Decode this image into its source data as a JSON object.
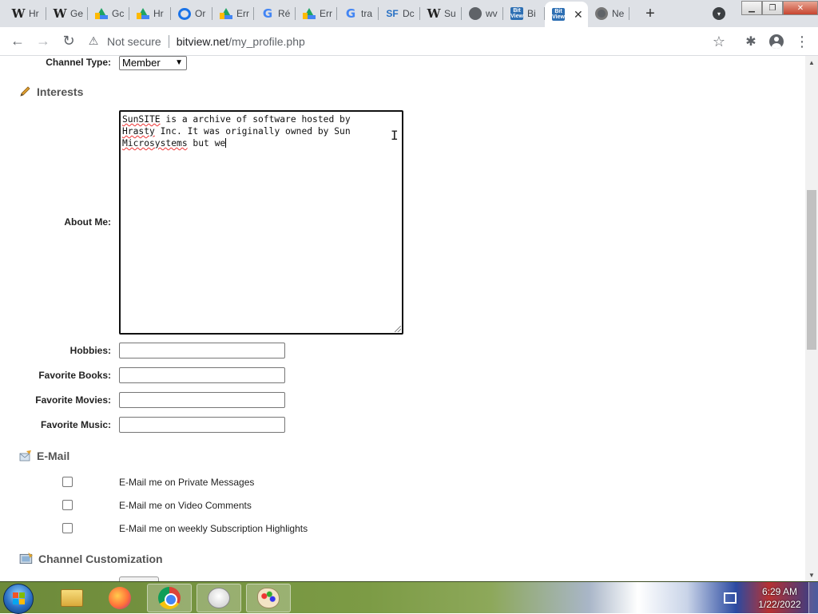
{
  "browser": {
    "tabs": [
      {
        "icon": "wikipedia-icon",
        "label": "Hr"
      },
      {
        "icon": "wikipedia-icon",
        "label": "Ge"
      },
      {
        "icon": "google-drive-icon",
        "label": "Gc"
      },
      {
        "icon": "google-drive-icon",
        "label": "Hr"
      },
      {
        "icon": "onedrive-icon",
        "label": "Or"
      },
      {
        "icon": "google-drive-icon",
        "label": "Err"
      },
      {
        "icon": "google-icon",
        "label": "Ré"
      },
      {
        "icon": "google-drive-icon",
        "label": "Err"
      },
      {
        "icon": "google-icon",
        "label": "tra"
      },
      {
        "icon": "sourceforge-icon",
        "label": "Dc"
      },
      {
        "icon": "wikipedia-icon",
        "label": "Su"
      },
      {
        "icon": "globe-icon",
        "label": "wv"
      },
      {
        "icon": "bitview-icon",
        "label": "Bi"
      },
      {
        "icon": "bitview-icon",
        "label": "",
        "active": true
      },
      {
        "icon": "chrome-icon",
        "label": "Ne"
      }
    ],
    "new_tab_label": "+",
    "address": {
      "security_text": "Not secure",
      "host": "bitview.net",
      "path": "/my_profile.php"
    },
    "icon_texts": {
      "back": "←",
      "forward": "→",
      "reload": "↻",
      "warning": "⚠",
      "star": "☆",
      "extensions": "✱",
      "menu": "⋮",
      "close": "✕",
      "minimize": "▁",
      "restore": "❐",
      "tab_search": "▾"
    }
  },
  "profile_form": {
    "channel_type_label": "Channel Type:",
    "channel_type_value": "Member",
    "interests_heading": "Interests",
    "about_me_label": "About Me:",
    "about_me": {
      "line1_word1": "SunSITE",
      "line1_rest": " is a archive of software hosted by",
      "line2_word1": "Hrasty",
      "line2_rest": " Inc. It was originally owned by Sun",
      "line3_word1": "Microsystems",
      "line3_rest": " but we"
    },
    "hobbies_label": "Hobbies:",
    "hobbies_value": "",
    "books_label": "Favorite Books:",
    "books_value": "",
    "movies_label": "Favorite Movies:",
    "movies_value": "",
    "music_label": "Favorite Music:",
    "music_value": "",
    "email_heading": "E-Mail",
    "email_options": [
      {
        "label": "E-Mail me on Private Messages",
        "checked": false
      },
      {
        "label": "E-Mail me on Video Comments",
        "checked": false
      },
      {
        "label": "E-Mail me on weekly Subscription Highlights",
        "checked": false
      }
    ],
    "customization_heading": "Channel Customization"
  },
  "taskbar": {
    "apps": [
      "windows-explorer",
      "firefox",
      "chrome",
      "snipping-tool",
      "paint"
    ],
    "clock_time": "6:29 AM",
    "clock_date": "1/22/2022"
  }
}
